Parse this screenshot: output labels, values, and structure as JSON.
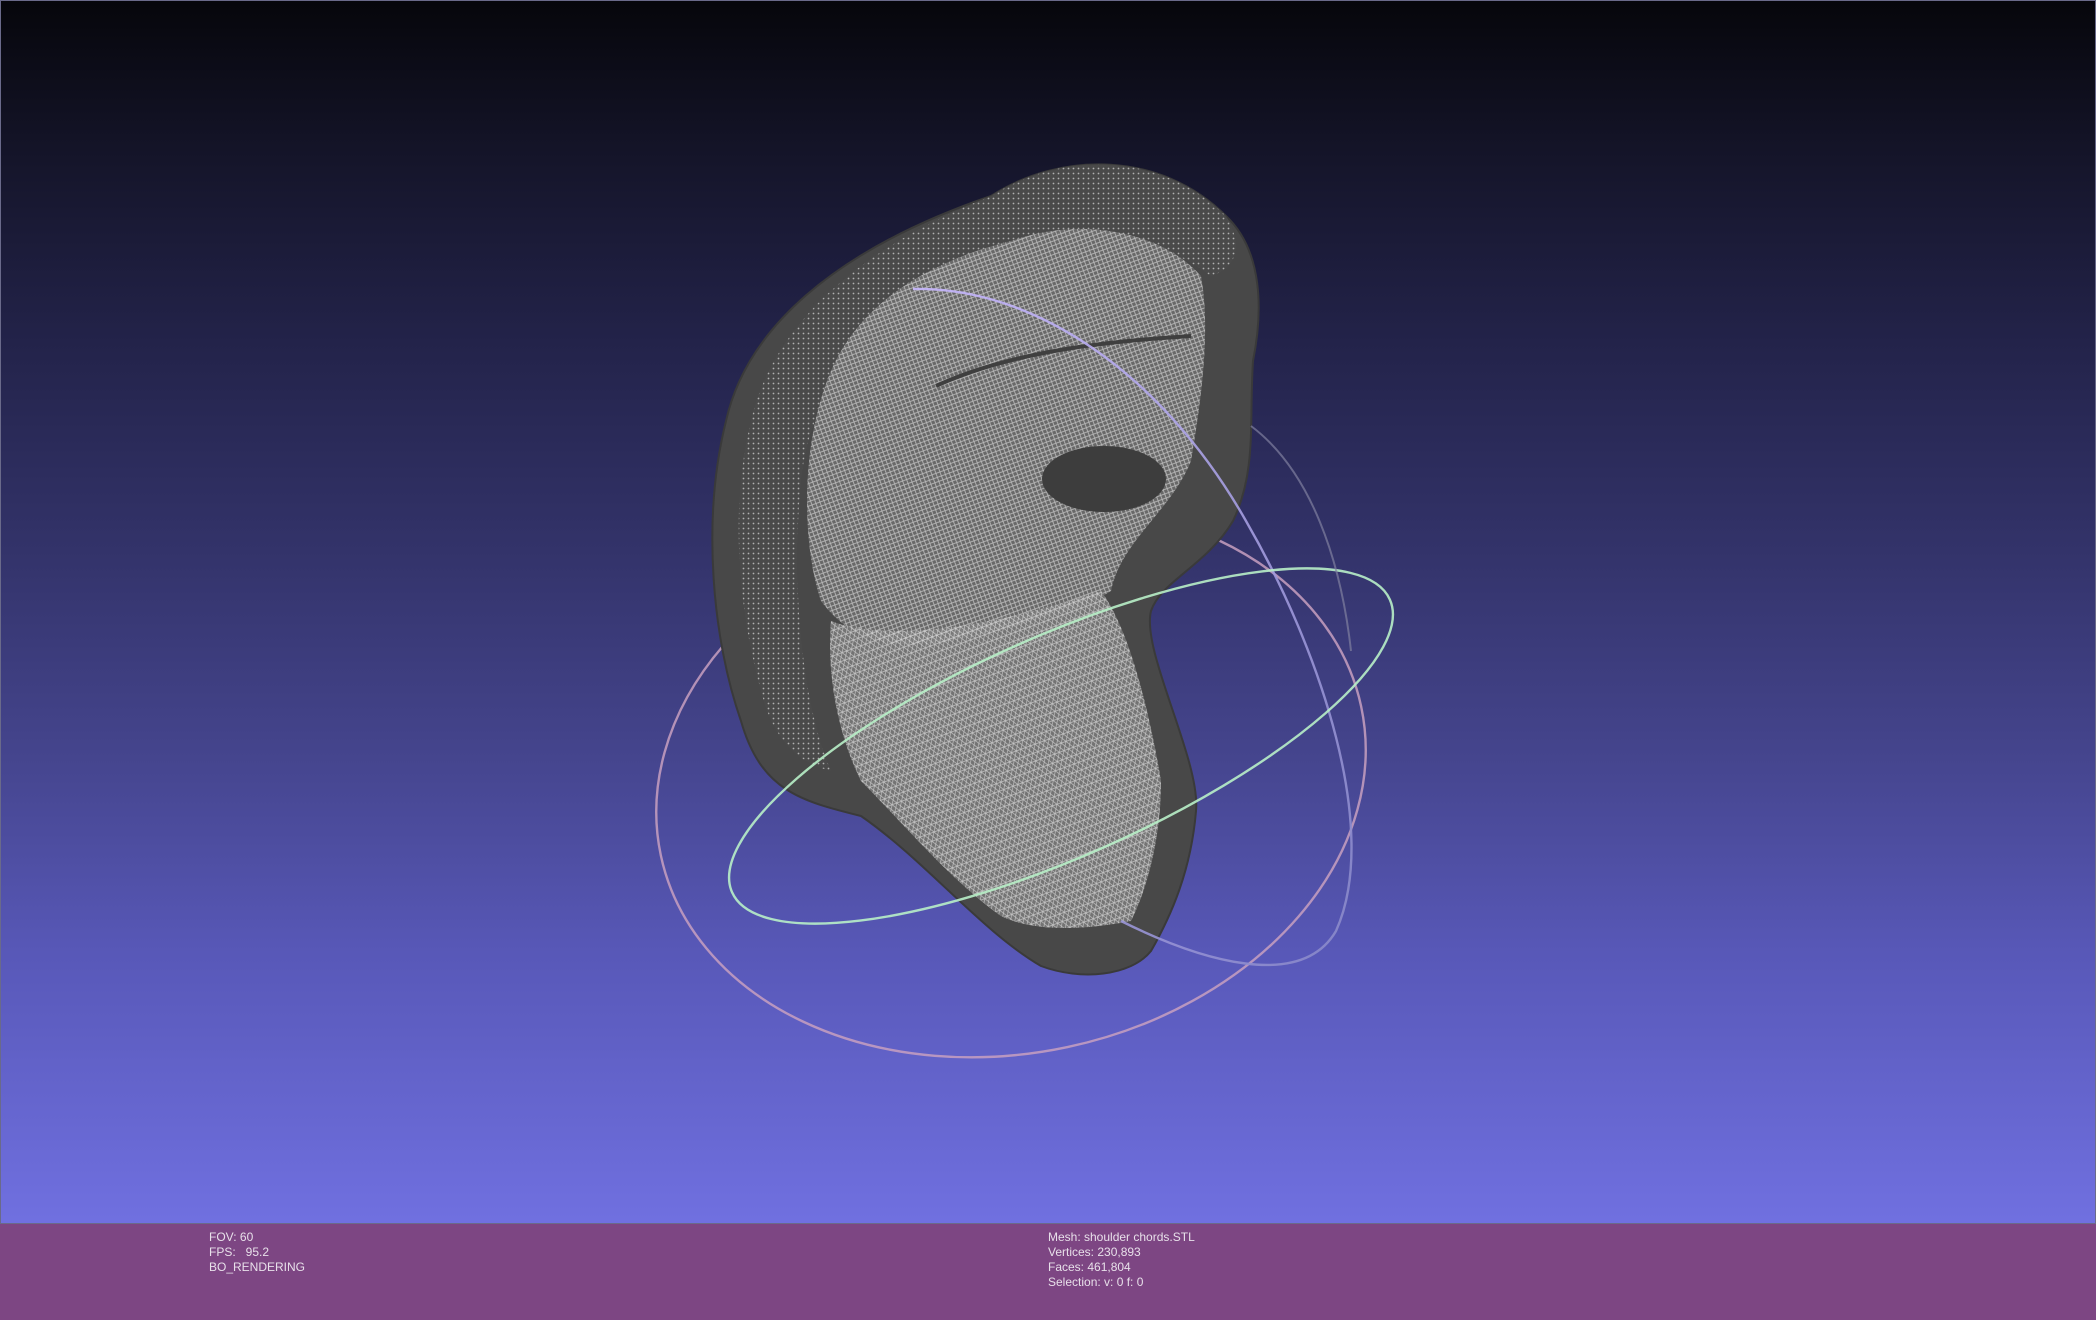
{
  "viewport": {
    "background_top": "#06060b",
    "background_bottom": "#7070e0",
    "mesh_color": "#4a4a4a",
    "wireframe_color": "#cfcfcf",
    "trackball_colors": {
      "x_ring": "#b8a8e8",
      "y_ring": "#a8f0b8",
      "z_ring": "#d8a8c0"
    }
  },
  "status_bar": {
    "background": "#7d4683",
    "left": {
      "fov": "FOV: 60",
      "fps": "FPS:   95.2",
      "mode": "BO_RENDERING"
    },
    "right": {
      "mesh": "Mesh: shoulder chords.STL",
      "vertices": "Vertices: 230,893",
      "faces": "Faces: 461,804",
      "selection": "Selection: v: 0 f: 0"
    }
  }
}
